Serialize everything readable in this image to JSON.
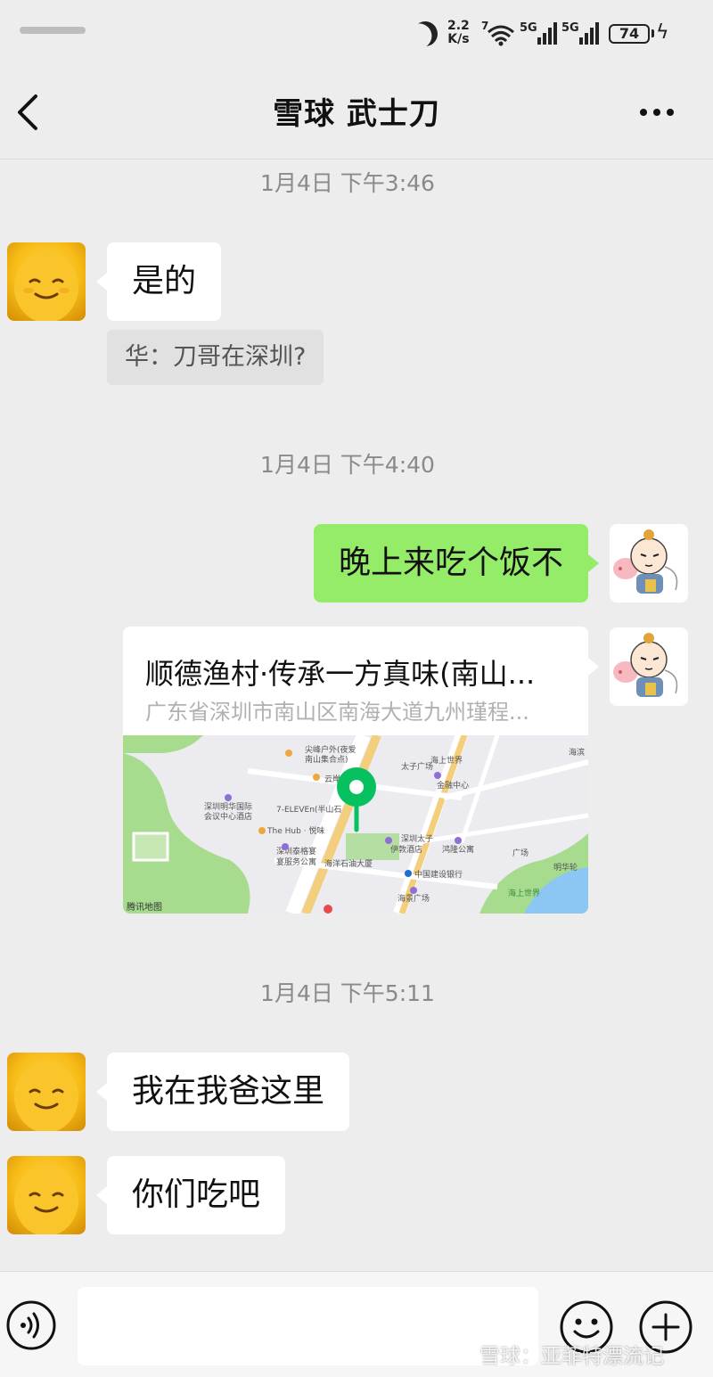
{
  "status_bar": {
    "net_speed_value": "2.2",
    "net_speed_unit": "K/s",
    "wifi_badge": "7",
    "sim1_label": "5G",
    "sim2_label": "5G",
    "battery_level": "74"
  },
  "header": {
    "title": "雪球 武士刀",
    "back_icon": "chevron-left-icon",
    "more_icon": "more-dots-icon"
  },
  "messages": {
    "ts1": "1月4日 下午3:46",
    "m1_text": "是的",
    "m1_quote": "华：刀哥在深圳?",
    "ts2": "1月4日 下午4:40",
    "m2_text": "晚上来吃个饭不",
    "m3_location": {
      "name": "顺德渔村·传承一方真味(南山...",
      "address": "广东省深圳市南山区南海大道九州瑾程...",
      "map": {
        "pois": [
          "尖峰户外(夜爱",
          "南山集合点)",
          "云岸文",
          "深圳明华国际",
          "会议中心酒店",
          "7-ELEVEn(半山石",
          "The Hub · 悦味",
          "深圳泰格宴",
          "宴服务公寓",
          "海洋石油大厦",
          "深圳太子",
          "伊敦酒店",
          "鸿隆公寓",
          "中国建设银行",
          "海景广场",
          "海上世界",
          "太子广场",
          "金融中心",
          "广场",
          "明华轮",
          "海上世界",
          "海滨"
        ],
        "provider": "腾讯地图"
      }
    },
    "ts3": "1月4日 下午5:11",
    "m4_text": "我在我爸这里",
    "m5_text": "你们吃吧"
  },
  "input_bar": {
    "placeholder": "",
    "voice_icon": "voice-icon",
    "emoji_icon": "emoji-icon",
    "plus_icon": "plus-icon"
  },
  "watermark": "雪球：亚菲特漂流记",
  "colors": {
    "background": "#ededed",
    "outgoing_bubble": "#95ec69",
    "incoming_bubble": "#ffffff",
    "map_pin": "#07c160"
  }
}
